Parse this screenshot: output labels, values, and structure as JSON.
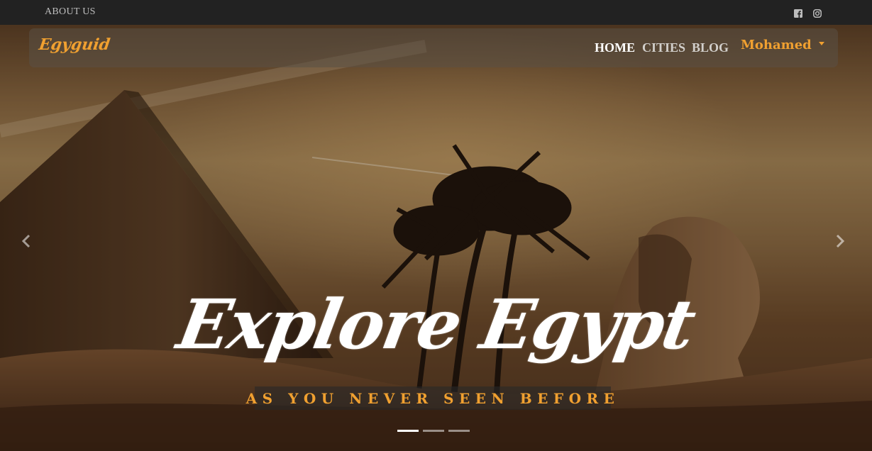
{
  "topbar": {
    "about_label": "ABOUT US",
    "social_icons": [
      "facebook-square-icon",
      "instagram-icon"
    ]
  },
  "navbar": {
    "brand": "Egyguid",
    "links": [
      {
        "label": "HOME",
        "active": true
      },
      {
        "label": "CITIES",
        "active": false
      },
      {
        "label": "BLOG",
        "active": false
      }
    ],
    "user_name": "Mohamed"
  },
  "hero": {
    "headline": "Explore Egypt",
    "subline": "AS YOU NEVER SEEN BEFORE",
    "slide_count": 3,
    "active_slide": 1
  },
  "colors": {
    "accent": "#f0a030",
    "topbar_bg": "#222222"
  }
}
